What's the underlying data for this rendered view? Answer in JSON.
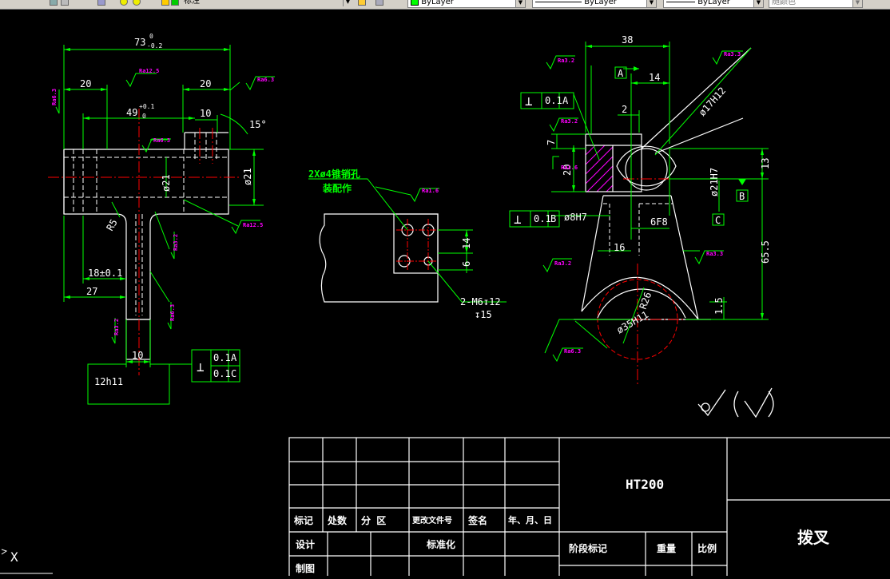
{
  "toolbar": {
    "text_style": "标注",
    "color": "ByLayer",
    "linetype": "ByLayer",
    "lineweight": "ByLayer",
    "plot_style": "随颜色"
  },
  "drawing": {
    "left_view": {
      "dims": {
        "overall": "73",
        "overall_tol_upper": "0",
        "overall_tol_lower": "-0.2",
        "left20": "20",
        "right20": "20",
        "d49": "49",
        "d49_tol_upper": "+0.1",
        "d49_tol_lower": "0",
        "d10top": "10",
        "angle": "15°",
        "dia21a": "ø21",
        "dia21b": "ø21",
        "r5": "R5",
        "d18": "18±0.1",
        "d27": "27",
        "d10b": "10",
        "d12h11": "12h11"
      },
      "roughness": [
        "Ra12.5",
        "Ra6.3",
        "Ra6.3",
        "Ra6.3",
        "Ra12.5",
        "Ra3.2",
        "Ra6.3",
        "Ra3.2",
        "Ra6.3"
      ],
      "fcf": {
        "symbol": "⊥",
        "row1_value": "0.1",
        "row1_datum": "A",
        "row2_value": "0.1",
        "row2_datum": "C"
      }
    },
    "mid_view": {
      "note_line1": "2Xø4锥销孔",
      "note_line2": "装配作",
      "thread_note": "2-M6↧12",
      "thread_depth": "↧15",
      "d14": "14",
      "d6": "6",
      "roughness": "Ra1.6"
    },
    "right_view": {
      "dims": {
        "d38": "38",
        "d14": "14",
        "d2": "2",
        "dia17": "ø17H12",
        "d7": "7",
        "d20": "20",
        "d13": "13",
        "dia21h7": "ø21H7",
        "dia8h7": "ø8H7",
        "d6f8": "6F8",
        "d16": "16",
        "d65_5": "65.5",
        "r26": "R26",
        "dia35": "ø35H11",
        "d1_5": "1.5"
      },
      "datum_a": "A",
      "datum_b": "B",
      "datum_c": "C",
      "fcf1": {
        "symbol": "⊥",
        "value": "0.1",
        "datum": "A"
      },
      "fcf2": {
        "symbol": "⊥",
        "value": "0.1",
        "datum": "B"
      },
      "roughness": [
        "Ra3.2",
        "Ra3.3",
        "Ra3.2",
        "Ra1.6",
        "Ra3.2",
        "Ra6.3",
        "Ra3.3"
      ]
    },
    "other_roughness": "(√)"
  },
  "title_block": {
    "material": "HT200",
    "part_name": "拨叉",
    "row_mark": "标记",
    "row_count": "处数",
    "row_zone": "分 区",
    "row_change_doc": "更改文件号",
    "row_sign": "签名",
    "row_date": "年、月、日",
    "design": "设计",
    "standardize": "标准化",
    "drawn": "制图",
    "stage_mark": "阶段标记",
    "weight": "重量",
    "scale": "比例"
  },
  "ucs_label": "X",
  "colors": {
    "outline": "#ffffff",
    "dimension": "#00ff00",
    "roughness_text": "#ff00ff",
    "center": "#ff0000",
    "hatch": "#ff00ff",
    "toolbar_bg": "#d4d0c8"
  }
}
